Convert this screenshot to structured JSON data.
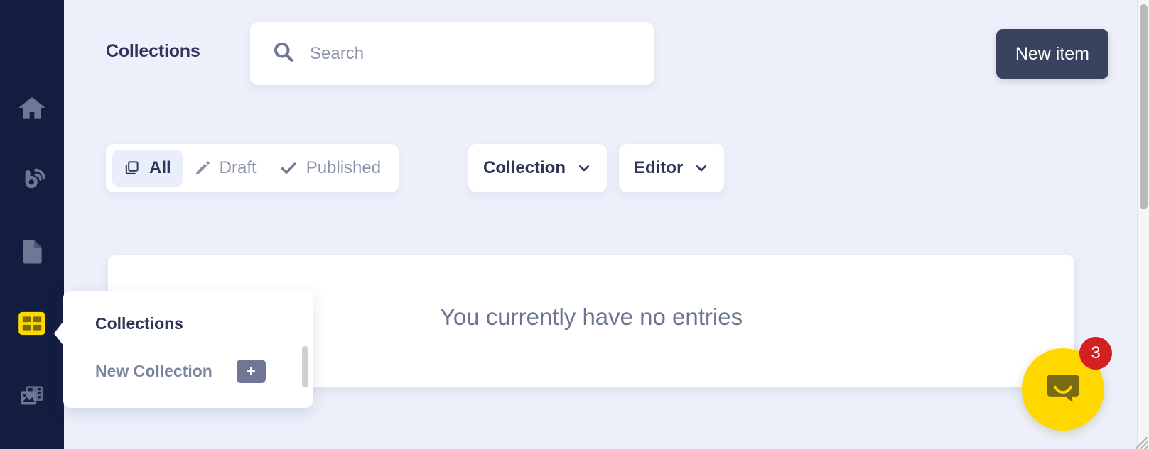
{
  "colors": {
    "sidebar_bg": "#131d3f",
    "page_bg": "#edf0fa",
    "accent_yellow": "#ffd800",
    "title_navy": "#2d3658",
    "muted_gray": "#8b93ad",
    "badge_red": "#d32121",
    "primary_button": "#39425f"
  },
  "sidebar": {
    "items": [
      {
        "name": "home",
        "icon": "home-icon",
        "active": false
      },
      {
        "name": "blog",
        "icon": "blog-rss-icon",
        "active": false
      },
      {
        "name": "pages",
        "icon": "document-icon",
        "active": false
      },
      {
        "name": "collections",
        "icon": "grid-collections-icon",
        "active": true
      },
      {
        "name": "media",
        "icon": "media-image-icon",
        "active": false
      }
    ]
  },
  "header": {
    "title": "Collections",
    "search": {
      "placeholder": "Search",
      "value": "",
      "icon": "search-icon"
    },
    "new_item_label": "New item"
  },
  "filters": {
    "tabs": [
      {
        "label": "All",
        "icon": "copy-layers-icon",
        "active": true
      },
      {
        "label": "Draft",
        "icon": "pencil-icon",
        "active": false
      },
      {
        "label": "Published",
        "icon": "check-icon",
        "active": false
      }
    ],
    "dropdowns": [
      {
        "label": "Collection",
        "icon": "chevron-down-icon"
      },
      {
        "label": "Editor",
        "icon": "chevron-down-icon"
      }
    ]
  },
  "main": {
    "empty_message": "You currently have no entries"
  },
  "flyout": {
    "title": "Collections",
    "new_collection_label": "New Collection",
    "add_button_label": "+"
  },
  "chat": {
    "icon": "chat-bubble-icon",
    "badge_count": "3"
  }
}
